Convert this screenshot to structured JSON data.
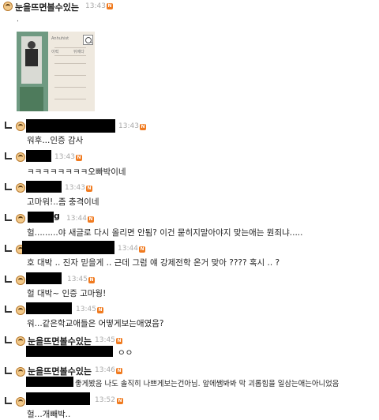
{
  "post": {
    "author": "눈을뜨면볼수있는",
    "time": "13:43",
    "badge": "N",
    "dot": ".",
    "thumb_texts": [
      "Anhuhist",
      "이력",
      "뒤에다"
    ],
    "zoom_icon": "magnifier-plus-icon"
  },
  "comments": [
    {
      "author": "",
      "time": "13:43",
      "text": "워후...인증 감사"
    },
    {
      "author": "",
      "time": "13:43",
      "text": "ㅋㅋㅋㅋㅋㅋㅋㅋ오빠박이네"
    },
    {
      "author": "",
      "time": "13:43",
      "text": "고마워!..좀 충격이네"
    },
    {
      "author": "g",
      "time": "13:44",
      "text": "헐.........야 새글로 다시 올리면 안됨? 이건 묻히지말아야지 맞는애는 뭔죄냐....."
    },
    {
      "author": "",
      "time": "13:44",
      "text": "호 대박 .. 진자 믿을게 .. 근데 그럼 얘 강제전학 온거 맞아 ???? 혹시 .. ?"
    },
    {
      "author": "",
      "time": "13:45",
      "text": "헐 대박~ 인증 고마웡!"
    },
    {
      "author": "",
      "time": "13:45",
      "text": "워...같은학교애들은 어떻게보는애였음?"
    },
    {
      "author": "눈을뜨면볼수있는",
      "time": "13:45",
      "text": "ㅇㅇ"
    },
    {
      "author": "눈을뜨면볼수있는",
      "time": "13:46",
      "text": "좋게봤음 나도 솔직히 나쁘게보는건아님. 앞에쌤봐봐 막 괴롭힘을 일삼는애는아니었음"
    },
    {
      "author": "",
      "time": "13:52",
      "text": "헐...개빼박.."
    }
  ],
  "colors": {
    "badge": "#f07a1f",
    "time": "#a9a9a9",
    "redact": "#000000",
    "background": "#ffffff"
  }
}
